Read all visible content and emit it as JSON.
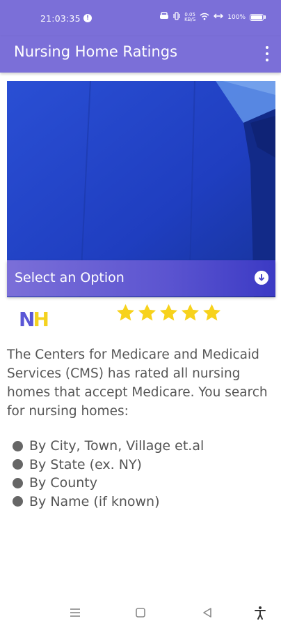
{
  "status_bar": {
    "time": "21:03:35",
    "network_speed": "0.05\nKB/S",
    "battery": "100%"
  },
  "app_bar": {
    "title": "Nursing Home Ratings"
  },
  "dropdown": {
    "label": "Select an Option",
    "icon": "arrow-down-circle-icon"
  },
  "logo": {
    "letter1": "N",
    "letter2": "H"
  },
  "rating": {
    "stars": 5,
    "max": 5,
    "color": "#f7d21c"
  },
  "description": "The Centers for Medicare and Medicaid Services (CMS) has rated all nursing homes that accept Medicare. You search for nursing homes:",
  "search_options": [
    "By City, Town, Village et.al",
    "By State (ex. NY)",
    "By County",
    "By Name (if known)"
  ],
  "colors": {
    "primary": "#7b6fd8",
    "hero_blue": "#1f3fc0",
    "star": "#f7d21c"
  }
}
